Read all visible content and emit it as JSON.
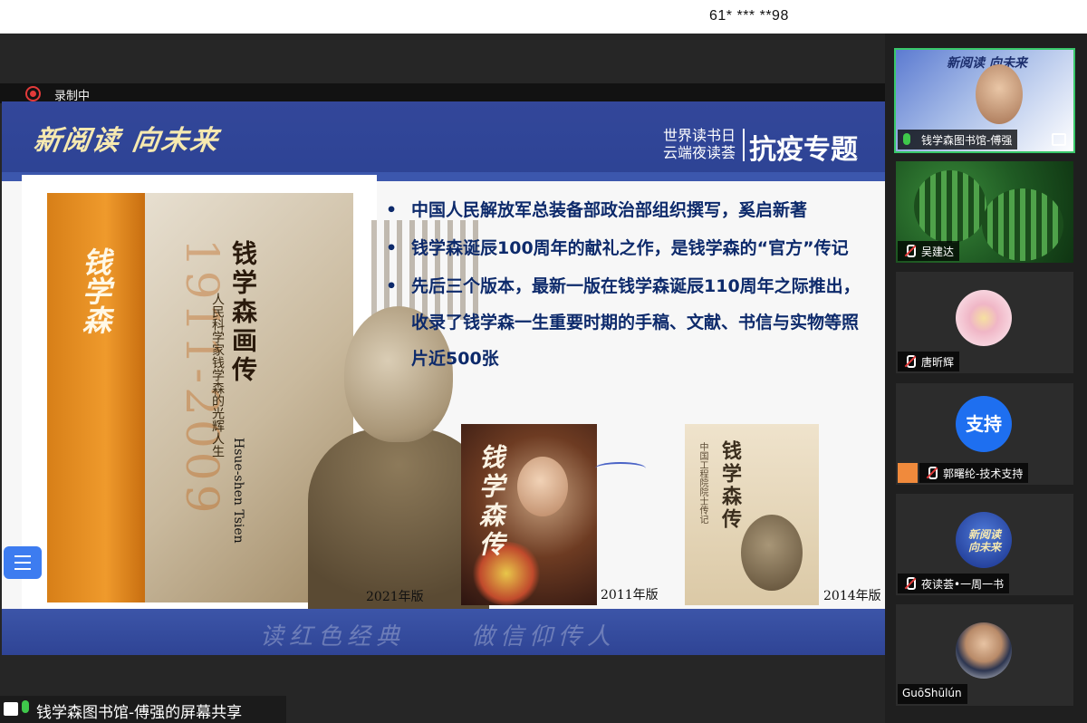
{
  "topbar": {
    "meeting_phone": "61* *** **98"
  },
  "recording": {
    "label": "录制中"
  },
  "slide": {
    "brand": "新阅读 向未来",
    "header_line1": "世界读书日",
    "header_line2": "云端夜读荟",
    "header_topic": "抗疫专题",
    "bullets": [
      "中国人民解放军总装备部政治部组织撰写，奚启新著",
      "钱学森诞辰100周年的献礼之作，是钱学森的“官方”传记",
      "先后三个版本，最新一版在钱学森诞辰110周年之际推出，收录了钱学森一生重要时期的手稿、文献、书信与实物等照片近500张"
    ],
    "book_main": {
      "title": "钱学森画传",
      "years": "1911-2009",
      "english": "Hsue-shen Tsien",
      "signature": "钱学森",
      "subtitle": "人民科学家钱学森的光辉人生"
    },
    "book_2011": {
      "cover_text": "钱学森传"
    },
    "book_2014": {
      "title": "钱学森传",
      "series": "中国工程院院士传记"
    },
    "editions": [
      "2021年版",
      "2011年版",
      "2014年版"
    ],
    "footer_left": "读红色经典",
    "footer_right": "做信仰传人"
  },
  "share_label": "钱学森图书馆-傅强的屏幕共享",
  "participants": [
    {
      "name": "钱学森图书馆-傅强",
      "mic": "on",
      "active": true
    },
    {
      "name": "吴建达",
      "mic": "off"
    },
    {
      "name": "唐昕辉",
      "mic": "off"
    },
    {
      "name": "郭曙纶-技术支持",
      "mic": "off",
      "avatar_text": "支持"
    },
    {
      "name": "夜读荟•一周一书",
      "mic": "off"
    },
    {
      "name": "GuōShūlún"
    }
  ],
  "tile1_banner": "新阅读 向未来",
  "tile5_logo": "新阅读 向未来",
  "colors": {
    "slide_blue": "#2d4394",
    "bullet_text": "#0d2a6b",
    "active_outline": "#39c86a",
    "record_red": "#e23a3a",
    "support_blue": "#1e6ff0"
  }
}
